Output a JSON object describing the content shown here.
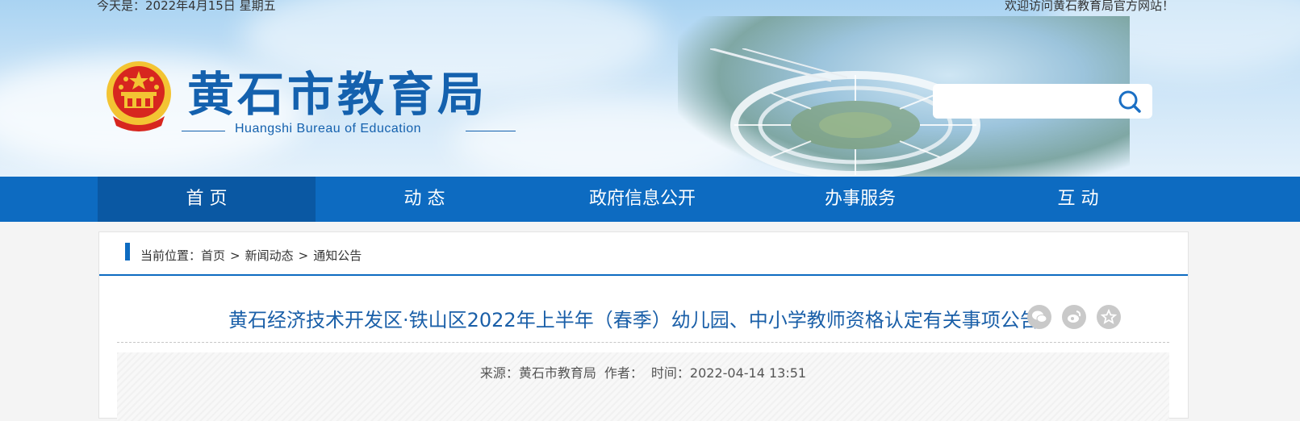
{
  "topbar": {
    "date_text": "今天是：2022年4月15日 星期五",
    "welcome_text": "欢迎访问黄石教育局官方网站！"
  },
  "header": {
    "site_title": "黄石市教育局",
    "site_subtitle": "Huangshi Bureau of Education",
    "emblem_icon": "national-emblem-icon",
    "search": {
      "placeholder": "",
      "icon": "search-icon"
    }
  },
  "nav": {
    "items": [
      {
        "label": "首 页",
        "active": true
      },
      {
        "label": "动 态",
        "active": false
      },
      {
        "label": "政府信息公开",
        "active": false
      },
      {
        "label": "办事服务",
        "active": false
      },
      {
        "label": "互 动",
        "active": false
      }
    ]
  },
  "breadcrumb": {
    "prefix": "当前位置：",
    "items": [
      "首页",
      "新闻动态",
      "通知公告"
    ],
    "separator": ">"
  },
  "article": {
    "title": "黄石经济技术开发区·铁山区2022年上半年（春季）幼儿园、中小学教师资格认定有关事项公告",
    "source": "来源：黄石市教育局",
    "author": "作者：",
    "time": "时间：2022-04-14 13:51",
    "share_icons": [
      "wechat-icon",
      "weibo-icon",
      "favorite-star-icon"
    ]
  },
  "colors": {
    "primary": "#0d6bc1",
    "nav_active": "#0a58a3",
    "title_blue": "#1a5fa8",
    "emblem_red": "#d7261f",
    "emblem_gold": "#f3c433"
  }
}
